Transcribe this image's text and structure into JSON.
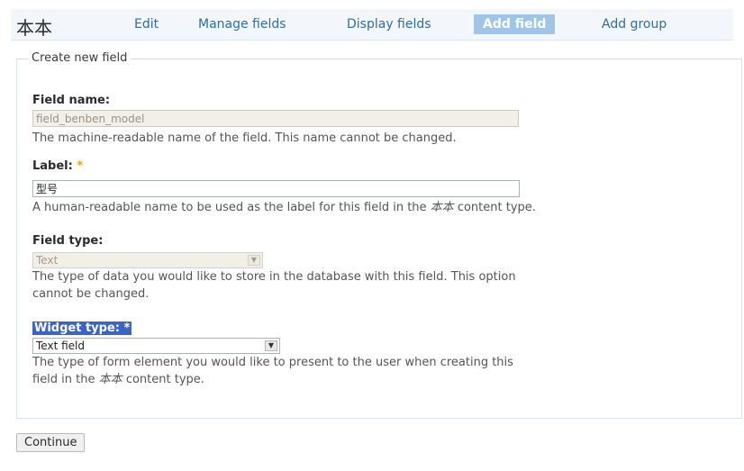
{
  "header": {
    "title": "本本",
    "tabs": [
      {
        "label": "Edit"
      },
      {
        "label": "Manage fields"
      },
      {
        "label": "Display fields"
      },
      {
        "label": "Add field"
      },
      {
        "label": "Add group"
      }
    ]
  },
  "form": {
    "legend": "Create new field",
    "field_name": {
      "label": "Field name:",
      "value": "field_benben_model",
      "description": "The machine-readable name of the field. This name cannot be changed."
    },
    "label_field": {
      "label": "Label:",
      "required_mark": "*",
      "value": "型号",
      "description_before": "A human-readable name to be used as the label for this field in the",
      "content_type": "本本",
      "description_after": "content type."
    },
    "field_type": {
      "label": "Field type:",
      "selected": "Text",
      "description_line1": "The type of data you would like to store in the database with this field. This option",
      "description_line2": "cannot be changed."
    },
    "widget_type": {
      "label": "Widget type: *",
      "selected": "Text field",
      "description_line1": "The type of form element you would like to present to the user when creating this",
      "description_before": "field in the",
      "content_type": "本本",
      "description_after": "content type."
    }
  },
  "actions": {
    "continue_label": "Continue"
  }
}
